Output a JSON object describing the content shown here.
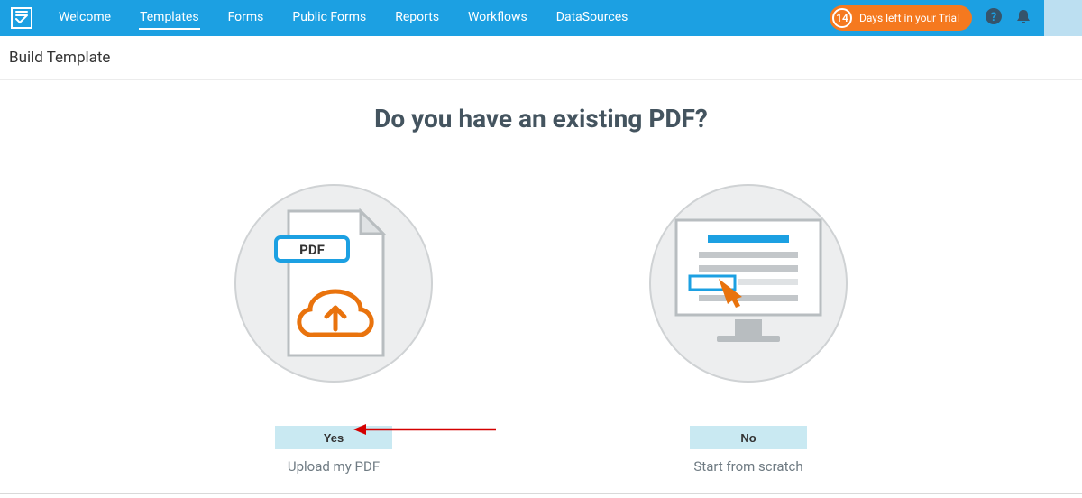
{
  "nav": {
    "items": [
      "Welcome",
      "Templates",
      "Forms",
      "Public Forms",
      "Reports",
      "Workflows",
      "DataSources"
    ],
    "active_index": 1
  },
  "trial": {
    "days": "14",
    "label": "Days left in your Trial"
  },
  "subheader": "Build Template",
  "main": {
    "title": "Do you have an existing PDF?"
  },
  "options": {
    "yes": {
      "button": "Yes",
      "caption": "Upload my PDF",
      "pdf_label": "PDF"
    },
    "no": {
      "button": "No",
      "caption": "Start from scratch"
    }
  }
}
